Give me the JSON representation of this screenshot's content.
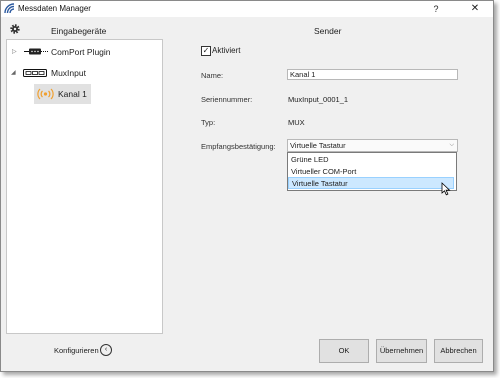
{
  "window": {
    "title": "Messdaten Manager",
    "help_label": "?",
    "close_label": "✕"
  },
  "left_panel": {
    "header": "Eingabegeräte",
    "tree": [
      {
        "label": "ComPort Plugin",
        "icon": "serial-port-icon"
      },
      {
        "label": "MuxInput",
        "icon": "mux-device-icon"
      },
      {
        "label": "Kanal 1",
        "icon": "radio-signal-icon",
        "selected": true
      }
    ],
    "config_label": "Konfigurieren",
    "config_icon_glyph": "‹"
  },
  "right_panel": {
    "header": "Sender",
    "activated_label": "Aktiviert",
    "activated_checked": true,
    "name_label": "Name:",
    "name_value": "Kanal 1",
    "serial_label": "Seriennummer:",
    "serial_value": "MuxInput_0001_1",
    "type_label": "Typ:",
    "type_value": "MUX",
    "ack_label": "Empfangsbestätigung:",
    "ack_value": "Virtuelle Tastatur",
    "ack_options": [
      "Grüne LED",
      "Virtueller COM-Port",
      "Virtuelle Tastatur"
    ]
  },
  "buttons": {
    "ok": "OK",
    "apply": "Übernehmen",
    "cancel": "Abbrechen"
  },
  "colors": {
    "accent_orange": "#f0a030",
    "selection_bg": "#cce8ff"
  }
}
